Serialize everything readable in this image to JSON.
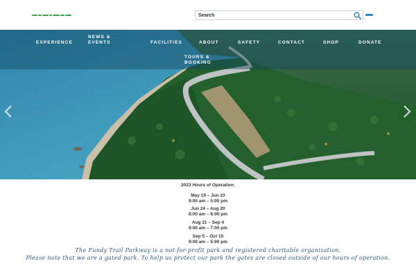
{
  "header": {
    "search_placeholder": "Search"
  },
  "nav": {
    "items": [
      {
        "label": "EXPERIENCE"
      },
      {
        "label": "NEWS & EVENTS"
      },
      {
        "label": "FACILITIES"
      },
      {
        "label": "ABOUT"
      },
      {
        "label": "SAFETY"
      },
      {
        "label": "CONTACT"
      },
      {
        "label": "SHOP"
      },
      {
        "label": "DONATE"
      },
      {
        "label": "TOURS & BOOKING"
      }
    ]
  },
  "hours": {
    "title": "2023 Hours of Operation:",
    "periods": [
      {
        "dates": "May 19 – Jun 23",
        "times": "9:00 am – 5:00 pm"
      },
      {
        "dates": "Jun 24 – Aug 20",
        "times": "8:00 am – 8:00 pm"
      },
      {
        "dates": "Aug 21 – Sep 4",
        "times": "9:00 am – 7:00 pm"
      },
      {
        "dates": "Sep 5 – Oct 15",
        "times": "9:00 am – 5:00 pm"
      }
    ]
  },
  "notes": {
    "line1": "The Fundy Trail Parkway is a not-for-profit park and registered charitable organization.",
    "line2": "Please note that we are a gated park. To help us protect our park the gates are closed outside of our hours of operation."
  },
  "colors": {
    "accent": "#2b88c6",
    "logo_green": "#3f9a4c",
    "water": "#4fa9c6",
    "forest": "#1f5a2a",
    "note_text": "#2f5a73"
  },
  "icons": {
    "search": "search-icon",
    "menu": "hamburger-menu-icon",
    "prev": "chevron-left-icon",
    "next": "chevron-right-icon"
  }
}
